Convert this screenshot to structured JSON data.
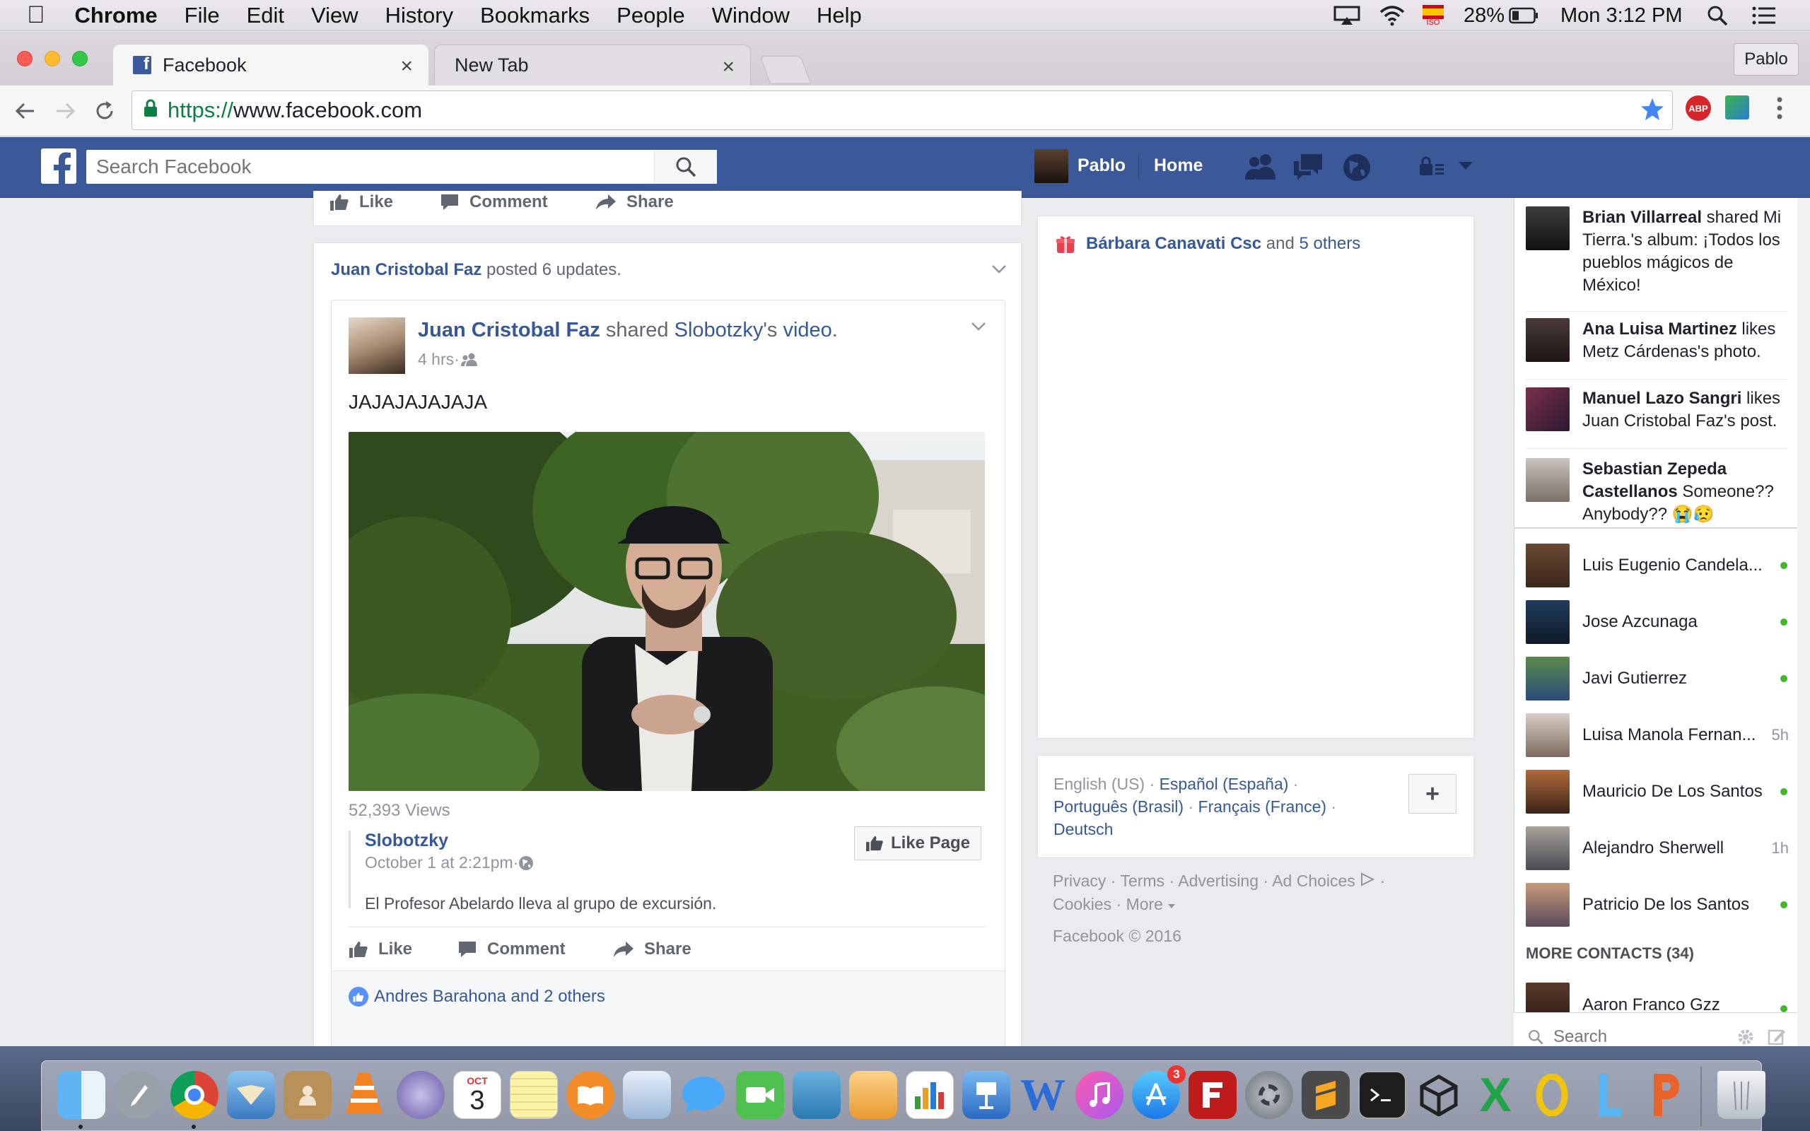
{
  "menubar": {
    "app": "Chrome",
    "items": [
      "File",
      "Edit",
      "View",
      "History",
      "Bookmarks",
      "People",
      "Window",
      "Help"
    ],
    "battery": "28%",
    "clock": "Mon 3:12 PM",
    "input_flag_label": "ISO"
  },
  "chrome": {
    "tabs": [
      {
        "title": "Facebook"
      },
      {
        "title": "New Tab"
      }
    ],
    "profile": "Pablo",
    "url_scheme": "https://",
    "url_host": "www.facebook.com",
    "abp_label": "ABP"
  },
  "fb": {
    "search_placeholder": "Search Facebook",
    "user": "Pablo",
    "home": "Home"
  },
  "top_actions": {
    "like": "Like",
    "comment": "Comment",
    "share": "Share"
  },
  "story": {
    "aggregate_name": "Juan Cristobal Faz",
    "aggregate_text": " posted 6 updates.",
    "author": "Juan Cristobal Faz",
    "verb": " shared ",
    "source": "Slobotzky",
    "possessive": "'s ",
    "object": "video",
    "period": ".",
    "time": "4 hrs",
    "separator": " · ",
    "message": "JAJAJAJAJAJA",
    "views": "52,393 Views",
    "page_name": "Slobotzky",
    "page_date": "October 1 at 2:21pm",
    "like_page": "Like Page",
    "description": "El Profesor Abelardo lleva al grupo de excursión.",
    "like": "Like",
    "comment": "Comment",
    "share": "Share",
    "reactions": "Andres Barahona and 2 others"
  },
  "right_col": {
    "birthday_name": "Bárbara Canavati Csc",
    "birthday_and": " and ",
    "birthday_others": "5 others",
    "languages": {
      "current": "English (US)",
      "dot": " · ",
      "espanol": "Español (España)",
      "portugues": "Português (Brasil)",
      "francais": "Français (France)",
      "deutsch": "Deutsch",
      "add": "+"
    },
    "footer": {
      "privacy": "Privacy",
      "terms": "Terms",
      "advertising": "Advertising",
      "ad_choices": "Ad Choices",
      "cookies": "Cookies",
      "more": "More",
      "copyright": "Facebook © 2016",
      "dot": " · "
    }
  },
  "ticker": [
    {
      "name": "Brian Villarreal",
      "text": " shared Mi Tierra.'s album: ¡Todos los pueblos mágicos de México!"
    },
    {
      "name": "Ana Luisa Martinez",
      "text": " likes Metz Cárdenas's photo."
    },
    {
      "name": "Manuel Lazo Sangri",
      "text": " likes Juan Cristobal Faz's post."
    },
    {
      "name": "Sebastian Zepeda Castellanos",
      "text": " Someone?? Anybody?? 😭😥"
    }
  ],
  "contacts": [
    {
      "name": "Luis Eugenio Candela...",
      "status": "online"
    },
    {
      "name": "Jose Azcunaga",
      "status": "online"
    },
    {
      "name": "Javi Gutierrez",
      "status": "online"
    },
    {
      "name": "Luisa Manola Fernan...",
      "status": "5h"
    },
    {
      "name": "Mauricio De Los Santos",
      "status": "online"
    },
    {
      "name": "Alejandro Sherwell",
      "status": "1h"
    },
    {
      "name": "Patricio De los Santos",
      "status": "online"
    }
  ],
  "more_contacts": "MORE CONTACTS (34)",
  "extra_contact": "Aaron Franco Gzz",
  "chat_search": "Search",
  "dock": {
    "calendar_month": "OCT",
    "calendar_day": "3",
    "appstore_badge": "3",
    "icons": [
      "finder-icon",
      "launchpad-icon",
      "chrome-icon",
      "mail-icon",
      "contacts-icon",
      "vlc-icon",
      "elgato-icon",
      "calendar-icon",
      "notes-icon",
      "ibooks-icon",
      "preview-icon",
      "messages-icon",
      "facetime-icon",
      "photo-booth-icon",
      "pages-icon",
      "numbers-icon",
      "keynote-icon",
      "word-icon",
      "itunes-icon",
      "app-store-icon",
      "filezilla-icon",
      "system-preferences-icon",
      "sublime-icon",
      "terminal-icon",
      "unity-icon",
      "excel-icon",
      "outlook-icon",
      "lync-icon",
      "powerpoint-icon",
      "trash-icon"
    ]
  }
}
